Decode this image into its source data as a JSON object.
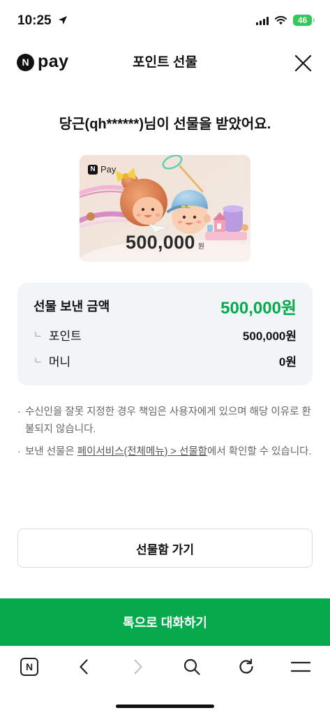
{
  "status_bar": {
    "time": "10:25",
    "battery_level": "46"
  },
  "header": {
    "logo_mark": "N",
    "logo_text": "pay",
    "title": "포인트 선물"
  },
  "message": "당근(qh******)님이 선물을 받았어요.",
  "gift_card": {
    "logo_mark": "N",
    "logo_text": "Pay",
    "amount": "500,000",
    "unit": "원"
  },
  "summary": {
    "total_label": "선물 보낸 금액",
    "total_value": "500,000원",
    "rows": [
      {
        "prefix": "ㄴ",
        "label": "포인트",
        "value": "500,000원"
      },
      {
        "prefix": "ㄴ",
        "label": "머니",
        "value": "0원"
      }
    ]
  },
  "notes": [
    {
      "bullet": "·",
      "text": "수신인을 잘못 지정한 경우 책임은 사용자에게 있으며 해당 이유로 환불되지 않습니다."
    },
    {
      "bullet": "·",
      "text_before": "보낸 선물은 ",
      "link": "페이서비스(전체메뉴) > 선물함",
      "text_after": "에서 확인할 수 있습니다."
    }
  ],
  "gift_box_button": "선물함 가기",
  "talk_button": "톡으로 대화하기",
  "toolbar": {
    "home_mark": "N"
  },
  "icons": {
    "status": [
      "location-arrow-icon",
      "cellular-signal-icon",
      "wifi-icon",
      "battery-icon"
    ],
    "header": [
      "naver-pay-logo",
      "close-icon"
    ],
    "toolbar": [
      "naver-home-icon",
      "back-chevron-icon",
      "forward-chevron-icon",
      "search-icon",
      "refresh-icon",
      "menu-icon"
    ]
  },
  "colors": {
    "brand_green": "#07a94d",
    "summary_background": "#f2f5f8",
    "battery_charging": "#34c759",
    "forward_disabled": "#c4c4c4"
  }
}
